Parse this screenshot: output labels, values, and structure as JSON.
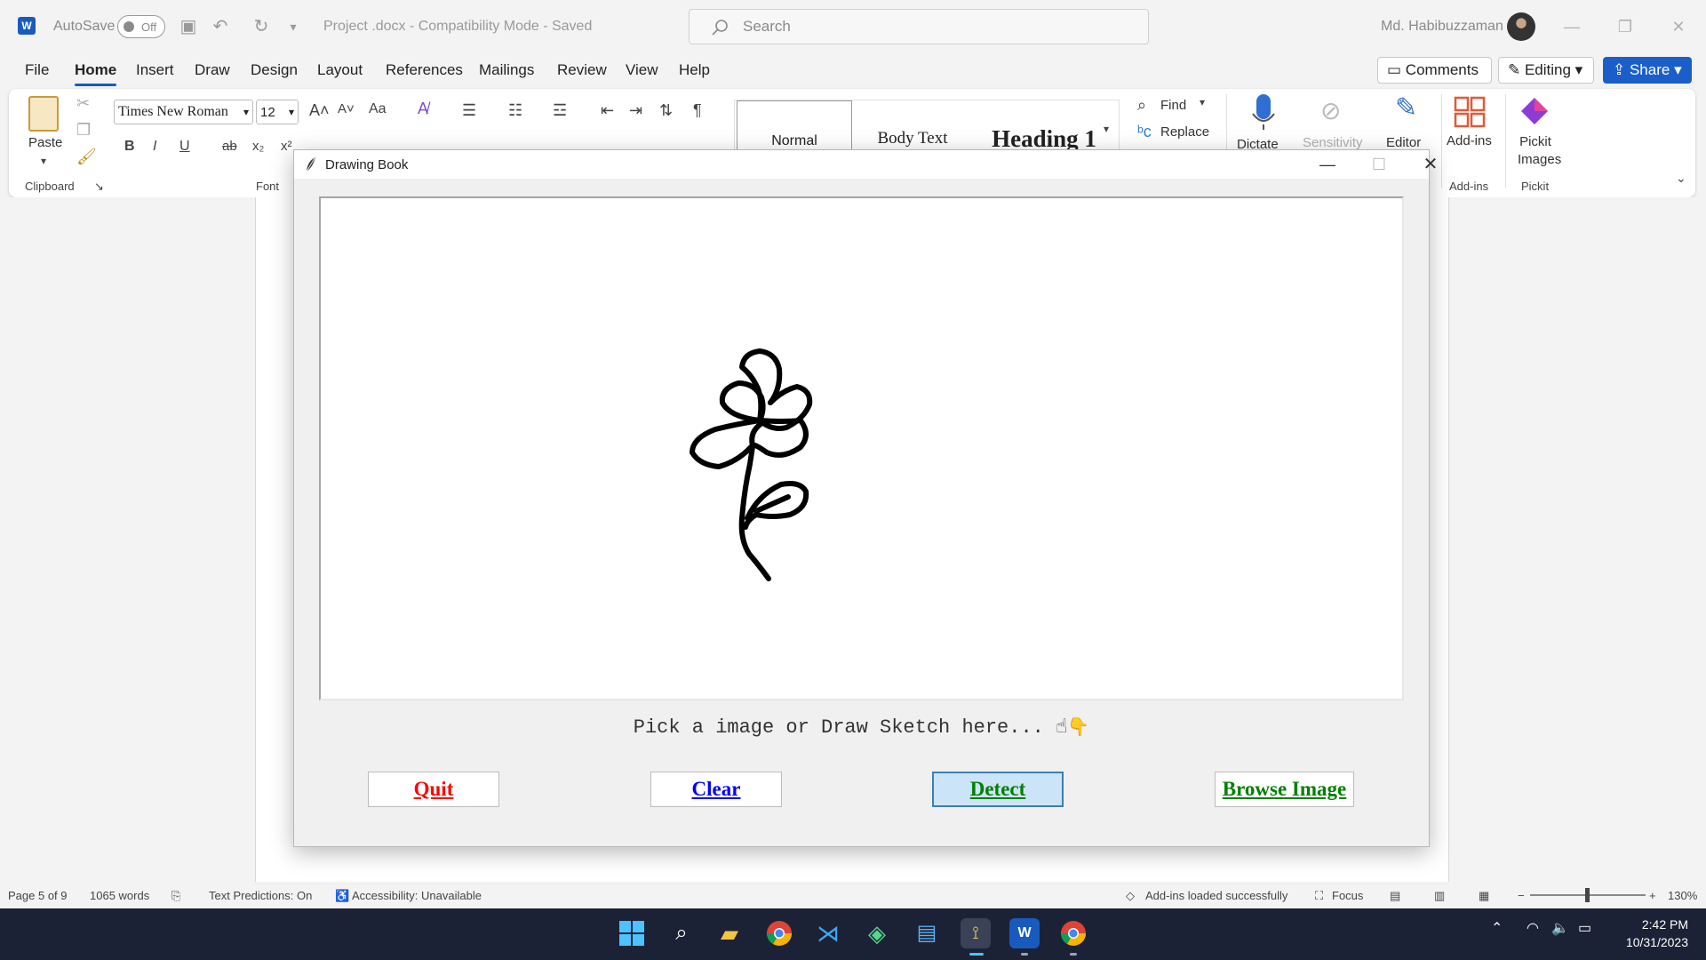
{
  "word": {
    "autosave_label": "AutoSave",
    "autosave_state": "Off",
    "doc_title": "Project .docx  -  Compatibility Mode  -  Saved",
    "search_placeholder": "Search",
    "user_name": "Md. Habibuzzaman",
    "tabs": [
      "File",
      "Home",
      "Insert",
      "Draw",
      "Design",
      "Layout",
      "References",
      "Mailings",
      "Review",
      "View",
      "Help"
    ],
    "active_tab": "Home",
    "comments_label": "Comments",
    "editing_label": "Editing",
    "share_label": "Share",
    "ribbon": {
      "paste_label": "Paste",
      "clipboard_label": "Clipboard",
      "font_name": "Times New Roman",
      "font_size": "12",
      "change_case": "Aa",
      "font_group_label": "Font",
      "styles": [
        "Normal",
        "Body Text",
        "Heading 1"
      ],
      "find_label": "Find",
      "replace_label": "Replace",
      "dictate_label": "Dictate",
      "sensitivity_label": "Sensitivity",
      "editor_label": "Editor",
      "addins_label": "Add-ins",
      "addins_group_label": "Add-ins",
      "pickit_label": "Pickit Images",
      "pickit_group_label": "Pickit"
    },
    "status": {
      "page": "Page 5 of 9",
      "words": "1065 words",
      "predictions": "Text Predictions: On",
      "accessibility": "Accessibility: Unavailable",
      "addins_msg": "Add-ins loaded successfully",
      "focus": "Focus",
      "zoom": "130%"
    }
  },
  "dialog": {
    "title": "Drawing Book",
    "hint": "Pick a image or Draw Sketch here...",
    "buttons": {
      "quit": "Quit",
      "clear": "Clear",
      "detect": "Detect",
      "browse": "Browse Image"
    },
    "colors": {
      "quit": "#ff0000",
      "clear": "#0000ff",
      "detect": "#008000",
      "browse": "#008000"
    }
  },
  "taskbar": {
    "time": "2:42 PM",
    "date": "10/31/2023",
    "apps": [
      "start-icon",
      "search-icon",
      "file-explorer-icon",
      "chrome-icon",
      "vscode-icon",
      "app-icon",
      "notepad-icon",
      "python-icon",
      "word-icon",
      "chrome-profile-icon"
    ]
  }
}
